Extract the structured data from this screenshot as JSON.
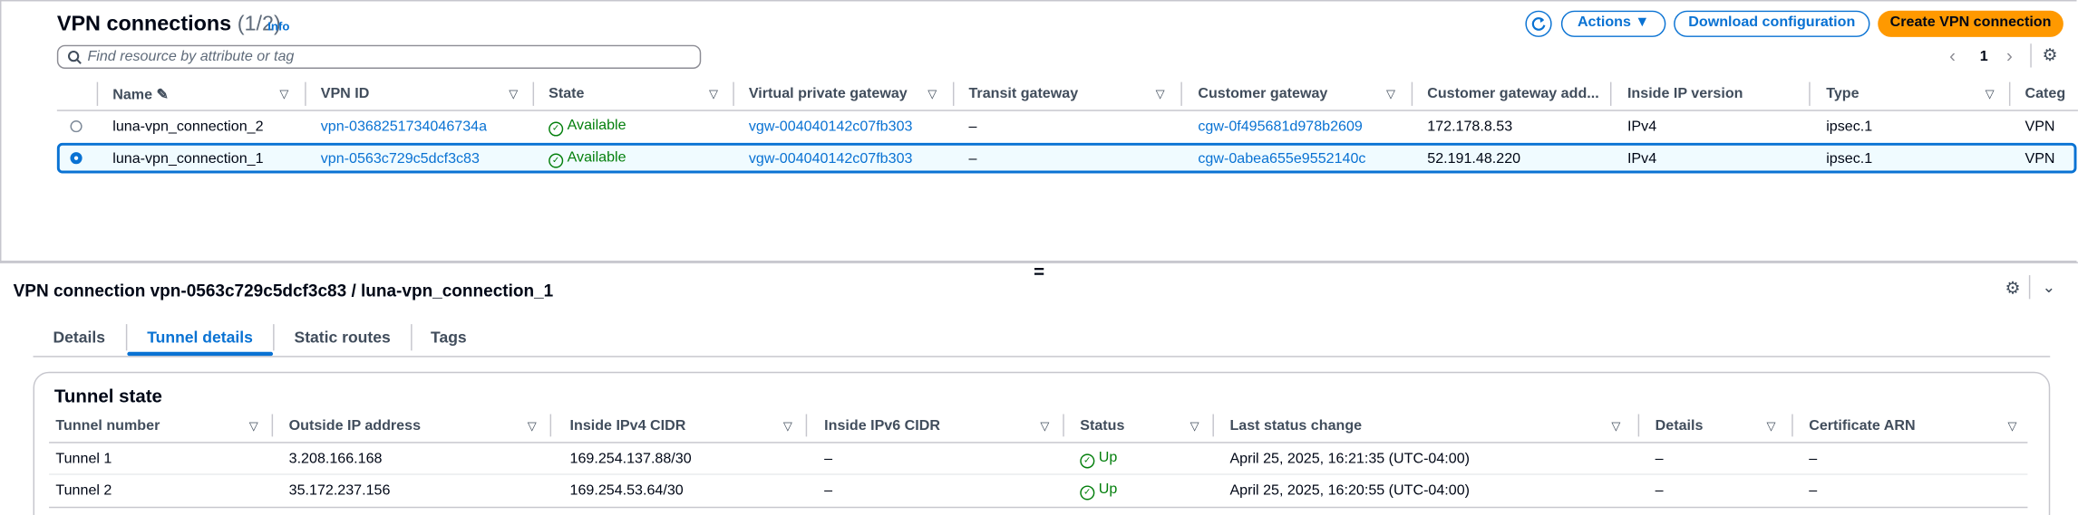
{
  "header": {
    "title": "VPN connections",
    "count": "(1/2)",
    "info": "Info"
  },
  "search": {
    "placeholder": "Find resource by attribute or tag"
  },
  "toolbar": {
    "refresh_icon": "refresh-icon",
    "actions": "Actions ▼",
    "download": "Download configuration",
    "create": "Create VPN connection"
  },
  "pagination": {
    "page": "1",
    "prev": "‹",
    "next": "›"
  },
  "table": {
    "columns": [
      "Name",
      "VPN ID",
      "State",
      "Virtual private gateway",
      "Transit gateway",
      "Customer gateway",
      "Customer gateway add...",
      "Inside IP version",
      "Type",
      "Categ"
    ],
    "rows": [
      {
        "selected": false,
        "name": "luna-vpn_connection_2",
        "vpn_id": "vpn-0368251734046734a",
        "state": "Available",
        "vgw": "vgw-004040142c07fb303",
        "tgw": "–",
        "cgw": "cgw-0f495681d978b2609",
        "cgw_addr": "172.178.8.53",
        "ip_version": "IPv4",
        "type": "ipsec.1",
        "category": "VPN"
      },
      {
        "selected": true,
        "name": "luna-vpn_connection_1",
        "vpn_id": "vpn-0563c729c5dcf3c83",
        "state": "Available",
        "vgw": "vgw-004040142c07fb303",
        "tgw": "–",
        "cgw": "cgw-0abea655e9552140c",
        "cgw_addr": "52.191.48.220",
        "ip_version": "IPv4",
        "type": "ipsec.1",
        "category": "VPN"
      }
    ]
  },
  "splitter": "=",
  "detail": {
    "title": "VPN connection vpn-0563c729c5dcf3c83 / luna-vpn_connection_1",
    "tabs": [
      "Details",
      "Tunnel details",
      "Static routes",
      "Tags"
    ],
    "active_tab": "Tunnel details",
    "card_title": "Tunnel state",
    "columns": [
      "Tunnel number",
      "Outside IP address",
      "Inside IPv4 CIDR",
      "Inside IPv6 CIDR",
      "Status",
      "Last status change",
      "Details",
      "Certificate ARN"
    ],
    "rows": [
      {
        "tunnel": "Tunnel 1",
        "outside_ip": "3.208.166.168",
        "ipv4": "169.254.137.88/30",
        "ipv6": "–",
        "status": "Up",
        "changed": "April 25, 2025, 16:21:35 (UTC-04:00)",
        "details": "–",
        "cert": "–"
      },
      {
        "tunnel": "Tunnel 2",
        "outside_ip": "35.172.237.156",
        "ipv4": "169.254.53.64/30",
        "ipv6": "–",
        "status": "Up",
        "changed": "April 25, 2025, 16:20:55 (UTC-04:00)",
        "details": "–",
        "cert": "–"
      }
    ]
  },
  "colors": {
    "link": "#0972d3",
    "primary": "#ff9900",
    "success": "#037f0c"
  }
}
